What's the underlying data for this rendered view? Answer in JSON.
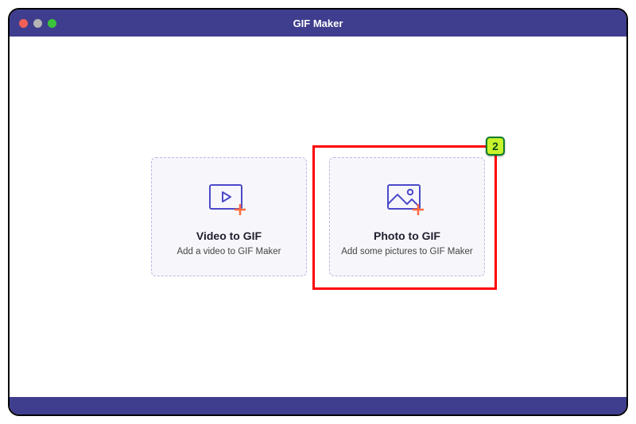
{
  "app": {
    "title": "GIF Maker"
  },
  "cards": {
    "video": {
      "title": "Video to GIF",
      "subtitle": "Add a video to GIF Maker"
    },
    "photo": {
      "title": "Photo to GIF",
      "subtitle": "Add some pictures to GIF Maker"
    }
  },
  "annotation": {
    "badge": "2"
  },
  "colors": {
    "titlebar": "#3f3d8e",
    "accent_plus": "#ff6b3d",
    "stroke": "#4b49c9"
  }
}
